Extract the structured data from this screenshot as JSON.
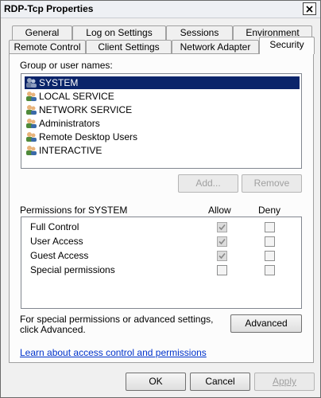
{
  "window": {
    "title": "RDP-Tcp Properties"
  },
  "tabs_top": [
    {
      "label": "General"
    },
    {
      "label": "Log on Settings"
    },
    {
      "label": "Sessions"
    },
    {
      "label": "Environment"
    }
  ],
  "tabs_bottom": [
    {
      "label": "Remote Control"
    },
    {
      "label": "Client Settings"
    },
    {
      "label": "Network Adapter"
    },
    {
      "label": "Security",
      "active": true
    }
  ],
  "security": {
    "group_label": "Group or user names:",
    "users": [
      {
        "name": "SYSTEM",
        "selected": true,
        "icon": "system-user-icon"
      },
      {
        "name": "LOCAL SERVICE",
        "icon": "user-group-icon"
      },
      {
        "name": "NETWORK SERVICE",
        "icon": "user-group-icon"
      },
      {
        "name": "Administrators",
        "icon": "user-group-icon"
      },
      {
        "name": "Remote Desktop Users",
        "icon": "user-group-icon"
      },
      {
        "name": "INTERACTIVE",
        "icon": "user-group-icon"
      }
    ],
    "add_label": "Add...",
    "remove_label": "Remove",
    "permissions_label": "Permissions for SYSTEM",
    "allow_header": "Allow",
    "deny_header": "Deny",
    "permissions": [
      {
        "name": "Full Control",
        "allow": true,
        "deny": false
      },
      {
        "name": "User Access",
        "allow": true,
        "deny": false
      },
      {
        "name": "Guest Access",
        "allow": true,
        "deny": false
      },
      {
        "name": "Special permissions",
        "allow": false,
        "deny": false
      }
    ],
    "advanced_text": "For special permissions or advanced settings, click Advanced.",
    "advanced_label": "Advanced",
    "learn_link": "Learn about access control and permissions"
  },
  "footer": {
    "ok_label": "OK",
    "cancel_label": "Cancel",
    "apply_label": "Apply"
  }
}
